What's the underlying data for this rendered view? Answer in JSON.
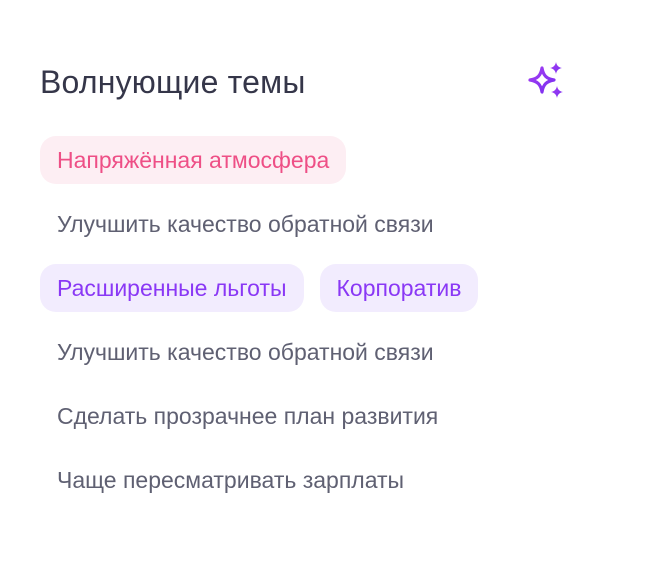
{
  "widget": {
    "title": "Волнующие темы",
    "icon": "sparkles-icon",
    "accent_color": "#9b3cf2"
  },
  "topics": [
    {
      "label": "Напряжённая атмосфера",
      "style": "highlight-pink",
      "color": "#ee4f86",
      "background": "#fdeef3"
    },
    {
      "label": "Улучшить качество обратной связи",
      "style": "plain"
    },
    {
      "label": "Расширенные льготы",
      "style": "highlight-purple",
      "color": "#8a38f5",
      "background": "#f2ecfe"
    },
    {
      "label": "Корпоратив",
      "style": "highlight-purple",
      "color": "#8a38f5",
      "background": "#f2ecfe"
    },
    {
      "label": "Улучшить качество обратной связи",
      "style": "plain"
    },
    {
      "label": "Сделать прозрачнее план развития",
      "style": "plain"
    },
    {
      "label": "Чаще пересматривать зарплаты",
      "style": "plain"
    }
  ]
}
